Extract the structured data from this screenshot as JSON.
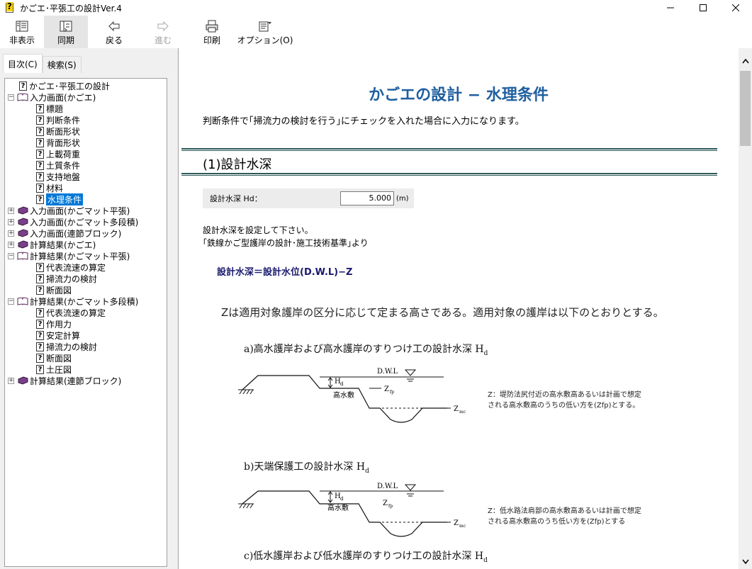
{
  "window": {
    "title": "かごエ･平張工の設計Ver.4",
    "minimize": "—",
    "maximize": "☐",
    "close": "✕"
  },
  "toolbar": {
    "hide": "非表示",
    "sync": "同期",
    "back": "戻る",
    "forward": "進む",
    "print": "印刷",
    "options": "オプション(O)"
  },
  "tabs": {
    "contents": "目次(C)",
    "search": "検索(S)"
  },
  "tree": [
    {
      "label": "かごエ･平張工の設計",
      "type": "page",
      "level": 1
    },
    {
      "label": "入力画面(かごエ)",
      "type": "open-book",
      "level": 0,
      "expand": "−"
    },
    {
      "label": "標題",
      "type": "page",
      "level": 2
    },
    {
      "label": "判断条件",
      "type": "page",
      "level": 2
    },
    {
      "label": "断面形状",
      "type": "page",
      "level": 2
    },
    {
      "label": "背面形状",
      "type": "page",
      "level": 2
    },
    {
      "label": "上載荷重",
      "type": "page",
      "level": 2
    },
    {
      "label": "土質条件",
      "type": "page",
      "level": 2
    },
    {
      "label": "支持地盤",
      "type": "page",
      "level": 2
    },
    {
      "label": "材料",
      "type": "page",
      "level": 2
    },
    {
      "label": "水理条件",
      "type": "page",
      "level": 2,
      "selected": true
    },
    {
      "label": "入力画面(かごマット平張)",
      "type": "book",
      "level": 0,
      "expand": "+"
    },
    {
      "label": "入力画面(かごマット多段積)",
      "type": "book",
      "level": 0,
      "expand": "+"
    },
    {
      "label": "入力画面(連節ブロック)",
      "type": "book",
      "level": 0,
      "expand": "+"
    },
    {
      "label": "計算結果(かごエ)",
      "type": "book",
      "level": 0,
      "expand": "+"
    },
    {
      "label": "計算結果(かごマット平張)",
      "type": "open-book",
      "level": 0,
      "expand": "−"
    },
    {
      "label": "代表流速の算定",
      "type": "page",
      "level": 2
    },
    {
      "label": "掃流力の検討",
      "type": "page",
      "level": 2
    },
    {
      "label": "断面図",
      "type": "page",
      "level": 2
    },
    {
      "label": "計算結果(かごマット多段積)",
      "type": "open-book",
      "level": 0,
      "expand": "−"
    },
    {
      "label": "代表流速の算定",
      "type": "page",
      "level": 2
    },
    {
      "label": "作用力",
      "type": "page",
      "level": 2
    },
    {
      "label": "安定計算",
      "type": "page",
      "level": 2
    },
    {
      "label": "掃流力の検討",
      "type": "page",
      "level": 2
    },
    {
      "label": "断面図",
      "type": "page",
      "level": 2
    },
    {
      "label": "土圧図",
      "type": "page",
      "level": 2
    },
    {
      "label": "計算結果(連節ブロック)",
      "type": "book",
      "level": 0,
      "expand": "+"
    }
  ],
  "content": {
    "title": "かごエの設計 − 水理条件",
    "intro": "判断条件で｢掃流力の検討を行う｣にチェックを入れた場合に入力になります。",
    "section1": "(1)設計水深",
    "input_label": "設計水深 Hd：",
    "input_value": "5.000",
    "input_unit": "(m)",
    "desc1": "設計水深を設定して下さい。",
    "desc2": "｢鉄線かご型護岸の設計･施工技術基準｣より",
    "formula": "設計水深＝設計水位(D.W.L)−Z",
    "z_sentence": "Zは適用対象護岸の区分に応じて定まる高さである。適用対象の護岸は以下のとおりとする。",
    "case_a": "a)高水護岸および高水護岸のすりつけ工の設計水深 H",
    "case_b": "b)天端保護工の設計水深 H",
    "case_c": "c)低水護岸および低水護岸のすりつけ工の設計水深 H",
    "sub_d": "d",
    "diagram": {
      "dwl": "D.W.L",
      "hd": "H",
      "hd_sub": "d",
      "high_bench": "高水敷",
      "z": "Z",
      "z_fp_sub": "fp",
      "z_mc_sub": "mc"
    },
    "note_a1": "Z：堤防法尻付近の高水敷高あるいは計画で想定",
    "note_a2": "される高水敷高のうちの低い方を(Zfp)とする。",
    "note_b1": "Z：低水路法肩部の高水敷高あるいは計画で想定",
    "note_b2": "される高水敷高のうち低い方を(Zfp)とする"
  }
}
